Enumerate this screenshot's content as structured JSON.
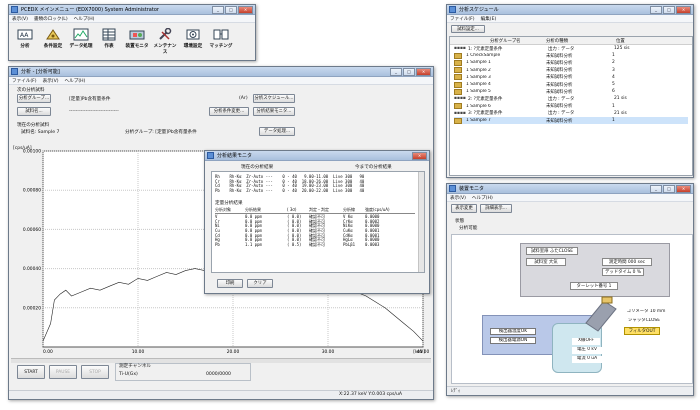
{
  "menu_window": {
    "title": "PCEDX メインメニュー (EDX7000) System Administrator",
    "menus": [
      "表示(V)",
      "書類のロック(L)",
      "ヘルプ(H)"
    ],
    "toolbar": [
      {
        "label": "分析",
        "icon": "analysis-icon"
      },
      {
        "label": "条件設定",
        "icon": "condition-icon"
      },
      {
        "label": "データ処理",
        "icon": "data-processing-icon"
      },
      {
        "label": "作表",
        "icon": "table-icon"
      },
      {
        "label": "装置モニタ",
        "icon": "monitor-icon"
      },
      {
        "label": "メンテナンス",
        "icon": "maintenance-icon"
      },
      {
        "label": "環境設定",
        "icon": "settings-icon"
      },
      {
        "label": "マッチング",
        "icon": "matching-icon"
      }
    ]
  },
  "analysis_window": {
    "title": "分析 - [分析可能]",
    "menus": [
      "ファイル(F)",
      "表示(V)",
      "ヘルプ(H)"
    ],
    "next_group_label": "次の分析試料",
    "group_button": "分析グループ...",
    "group_value": "[定量]Pb含有量条件",
    "unit_hint": "(Ar)",
    "schedule_button": "分析スケジュール...",
    "sample_button": "試料名...",
    "sample_value": "------------------------------",
    "condition_button": "分析条件変更...",
    "monitor_button": "分析結果モニタ...",
    "current_label": "現在の分析試料",
    "current_sample": "試料名: Sample 7",
    "current_group": "分析グループ: [定量]Pb含有量条件",
    "data_button": "データ処理...",
    "y_unit": "[cps/uA]",
    "x_unit": "[keV]",
    "y_ticks": [
      "0.00100",
      "0.00080",
      "0.00060",
      "0.00040",
      "0.00020"
    ],
    "x_ticks": [
      "0.00",
      "10.00",
      "20.00",
      "30.00",
      "40.00"
    ],
    "start_button": "START",
    "pause_button": "PAUSE",
    "stop_button": "STOP",
    "channel_label": "測定チャンネル",
    "channel_name": "Ti-U(Gx)",
    "channel_progress": "0000/0000",
    "status": "X:22.37 keV  Y:0.003 cps/uA"
  },
  "result_monitor": {
    "title": "分析結果モニタ",
    "current_result": "現在の分析結果",
    "prev_results": "今までの分析結果",
    "top_lines": [
      "Rh    Rh-Kα  Zr-Auto ---    0 - 40   9.00-11.00  Live 300   90",
      "Cr    Rh-Kα  Zr-Auto ---    0 - 40  18.00-26.00  Live 300   40",
      "Cd    Rh-Kα  Zr-Auto ---    0 - 40  19.00-23.00  Live 300   40",
      "Pb    Rh-Kα  Zr-Auto ---    0 - 40  20.00-22.00  Live 300   40"
    ],
    "quant_title": "定量分析結果",
    "quant_headers": [
      "分析対象",
      "分析結果",
      "( 3σ)",
      "判定・判定",
      "分析線",
      "強度(cps/uA)"
    ],
    "quant_rows": [
      [
        "V",
        "0.0 ppm",
        "( 0.0)",
        "確認不可",
        "V Kα",
        "0.0000"
      ],
      [
        "Cr",
        "0.0 ppm",
        "( 0.0)",
        "確認不可",
        "CrKα",
        "0.0002"
      ],
      [
        "Ni",
        "0.0 ppm",
        "( 0.0)",
        "確認不可",
        "NiKα",
        "0.0000"
      ],
      [
        "Cu",
        "0.0 ppm",
        "( 0.0)",
        "確認不可",
        "CuKα",
        "0.0001"
      ],
      [
        "Cd",
        "0.0 ppm",
        "( 0.0)",
        "確認不可",
        "CdKα",
        "0.0001"
      ],
      [
        "Hg",
        "0.0 ppm",
        "( 0.0)",
        "確認不可",
        "HgLα",
        "0.0000"
      ],
      [
        "Pb",
        "1.1 ppm",
        "( 0.5)",
        "確認不可",
        "PbLβ1",
        "0.0003"
      ]
    ],
    "print_button": "印刷",
    "clear_button": "クリア"
  },
  "schedule_window": {
    "title": "分析スケジュール",
    "menus": [
      "ファイル(F)",
      "編集(E)"
    ],
    "add_button": "試料設定...",
    "headers": [
      "",
      "分析グループ名",
      "分析の種類",
      "位置"
    ],
    "rows": [
      {
        "folder": false,
        "name": "1: ?元素定量条件",
        "type": "出力 : データ",
        "pos": "125   sis",
        "selected": false
      },
      {
        "folder": true,
        "name": "1 CheckSample",
        "type": "未知試料分析",
        "pos": "1",
        "selected": false
      },
      {
        "folder": true,
        "name": "1 Sample 1",
        "type": "未知試料分析",
        "pos": "2",
        "selected": false
      },
      {
        "folder": true,
        "name": "1 Sample 2",
        "type": "未知試料分析",
        "pos": "3",
        "selected": false
      },
      {
        "folder": true,
        "name": "1 Sample 3",
        "type": "未知試料分析",
        "pos": "4",
        "selected": false
      },
      {
        "folder": true,
        "name": "1 Sample 4",
        "type": "未知試料分析",
        "pos": "5",
        "selected": false
      },
      {
        "folder": true,
        "name": "1 Sample 5",
        "type": "未知試料分析",
        "pos": "6",
        "selected": false
      },
      {
        "folder": false,
        "name": "2: ?元素定量条件",
        "type": "出力 : データ",
        "pos": "21   sis",
        "selected": false
      },
      {
        "folder": true,
        "name": "1 Sample 6",
        "type": "未知試料分析",
        "pos": "1",
        "selected": false
      },
      {
        "folder": false,
        "name": "3: ?元素定量条件",
        "type": "出力 : データ",
        "pos": "21   sis",
        "selected": false
      },
      {
        "folder": true,
        "name": "1 Sample 7",
        "type": "未知試料分析",
        "pos": "1",
        "selected": true
      }
    ]
  },
  "device_window": {
    "title": "装置モニタ",
    "menus": [
      "表示(V)",
      "ヘルプ(H)"
    ],
    "show_button": "表示変更",
    "detail_button": "詳細表示...",
    "state_label": "状態",
    "state_value": "分析可能",
    "labels": {
      "door": "試料室扉  ふたCLOSE",
      "vacuum": "試料室  大気",
      "time": "測定時間  000 sec",
      "live": "デッドタイム  0 %",
      "turret": "ターレット番号  1",
      "collimator": "コリメータ 10 mm",
      "shutter": "シャッタCLOSE",
      "filter": "フィルタOUT",
      "det_temp": "検出器温度OK",
      "det_bias": "検出器電源ON",
      "xray": "X線OFF",
      "voltage": "電圧  0 kV",
      "current": "電流  0 uA"
    },
    "status": "ﾚﾃﾞｨ"
  },
  "chart_data": {
    "type": "line",
    "title": "",
    "xlabel": "[keV]",
    "ylabel": "[cps/uA]",
    "xlim": [
      0,
      40
    ],
    "ylim": [
      0,
      0.001
    ],
    "series": [
      {
        "x": [
          0,
          0.8,
          1.2,
          1.8,
          2.4,
          3,
          4,
          5,
          6,
          7,
          8,
          9,
          10,
          11,
          12,
          13,
          14,
          15,
          16,
          17,
          18,
          19,
          20,
          21,
          22,
          23,
          24,
          25,
          26,
          27,
          28,
          29,
          30,
          31,
          32,
          33,
          34,
          35,
          36,
          37,
          38,
          39,
          40
        ],
        "y": [
          3e-05,
          0.00012,
          0.00024,
          0.00027,
          0.00029,
          0.00026,
          0.00028,
          0.0003,
          0.00029,
          0.00031,
          0.00033,
          0.00032,
          0.00035,
          0.00034,
          0.00036,
          0.00038,
          0.00037,
          0.00039,
          0.0004,
          0.00039,
          0.00041,
          0.0004,
          0.00042,
          0.00041,
          0.0004,
          0.00042,
          0.00041,
          0.00039,
          0.0004,
          0.00038,
          0.00037,
          0.00036,
          0.00034,
          0.00032,
          0.0003,
          0.00028,
          0.00026,
          0.00023,
          0.0002,
          0.00016,
          0.00012,
          8e-05,
          3e-05
        ]
      }
    ]
  }
}
